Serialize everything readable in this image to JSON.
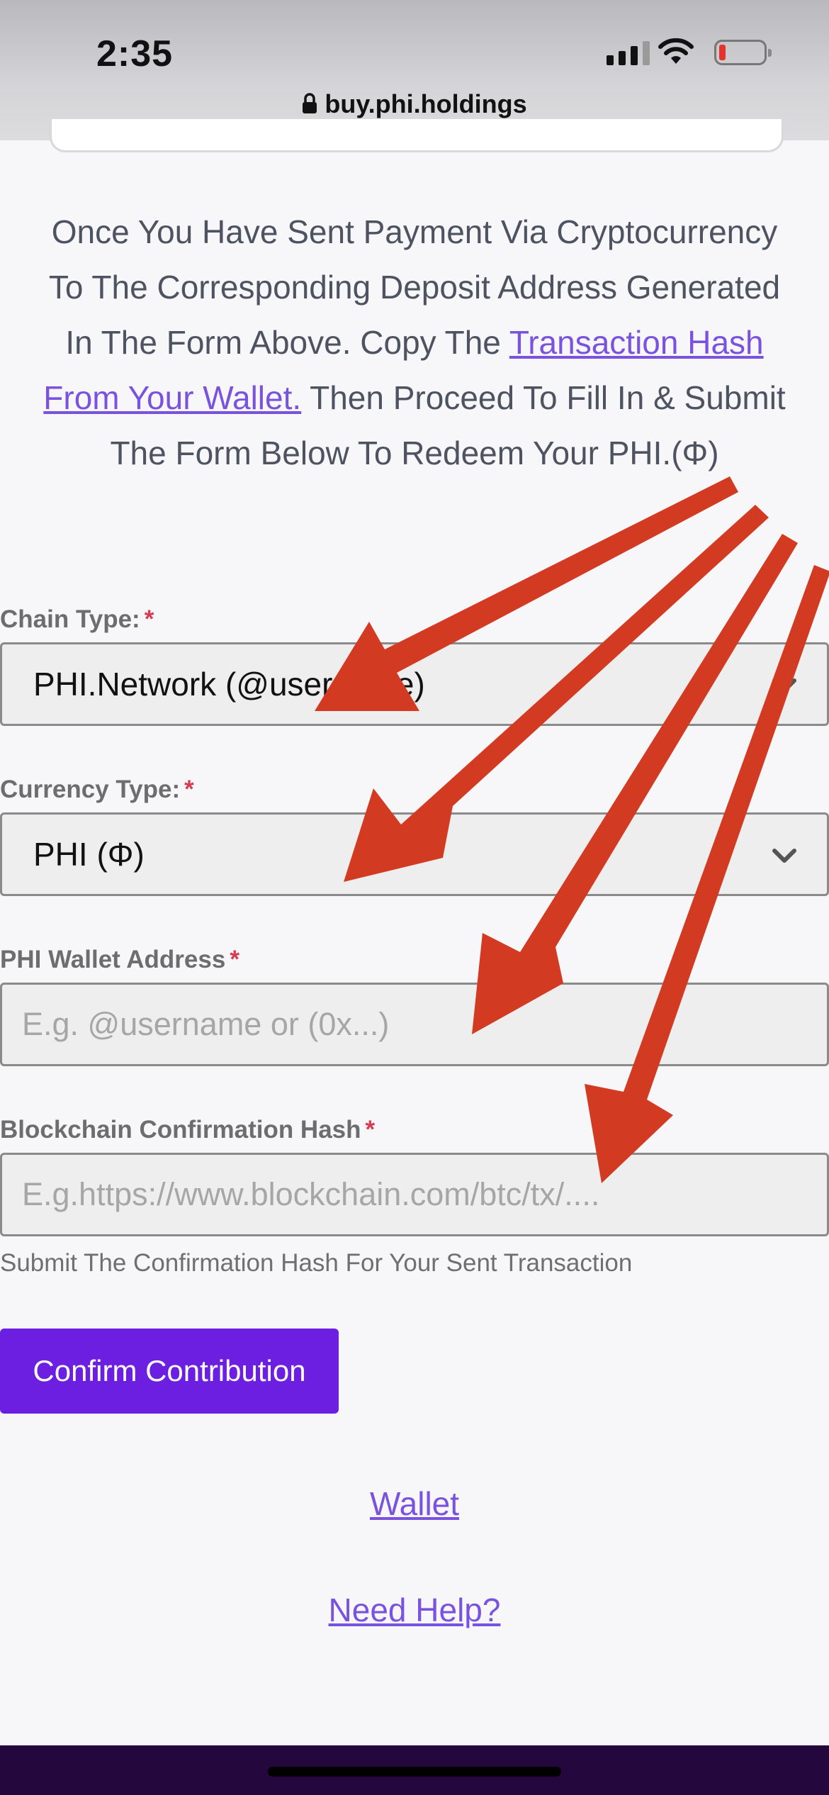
{
  "status": {
    "time": "2:35"
  },
  "browser": {
    "url": "buy.phi.holdings"
  },
  "intro": {
    "text_before": "Once You Have Sent Payment Via Cryptocurrency To The Corresponding Deposit Address Generated In The Form Above. Copy The ",
    "link": "Transaction Hash From Your Wallet.",
    "text_after": " Then Proceed To Fill In & Submit The Form Below To Redeem Your PHI.(Φ)"
  },
  "form": {
    "chain_type": {
      "label": "Chain Type:",
      "required": "*",
      "value": "PHI.Network (@username)"
    },
    "currency_type": {
      "label": "Currency Type:",
      "required": "*",
      "value": "PHI (Φ)"
    },
    "wallet_address": {
      "label": "PHI Wallet Address",
      "required": "*",
      "placeholder": "E.g. @username or (0x...)"
    },
    "confirmation_hash": {
      "label": "Blockchain Confirmation Hash",
      "required": "*",
      "placeholder": "E.g.https://www.blockchain.com/btc/tx/....",
      "help": "Submit The Confirmation Hash For Your Sent Transaction"
    },
    "submit_label": "Confirm Contribution"
  },
  "links": {
    "wallet": "Wallet",
    "help": "Need Help?"
  },
  "colors": {
    "accent": "#6c1fe0",
    "link": "#7a52e0",
    "arrow": "#d33a22",
    "required": "#d63c52",
    "footer": "#24073c"
  },
  "icons": {
    "lock": "lock-icon",
    "signal": "signal-icon",
    "wifi": "wifi-icon",
    "battery": "battery-icon",
    "select_chevron": "chevron-down-icon"
  }
}
